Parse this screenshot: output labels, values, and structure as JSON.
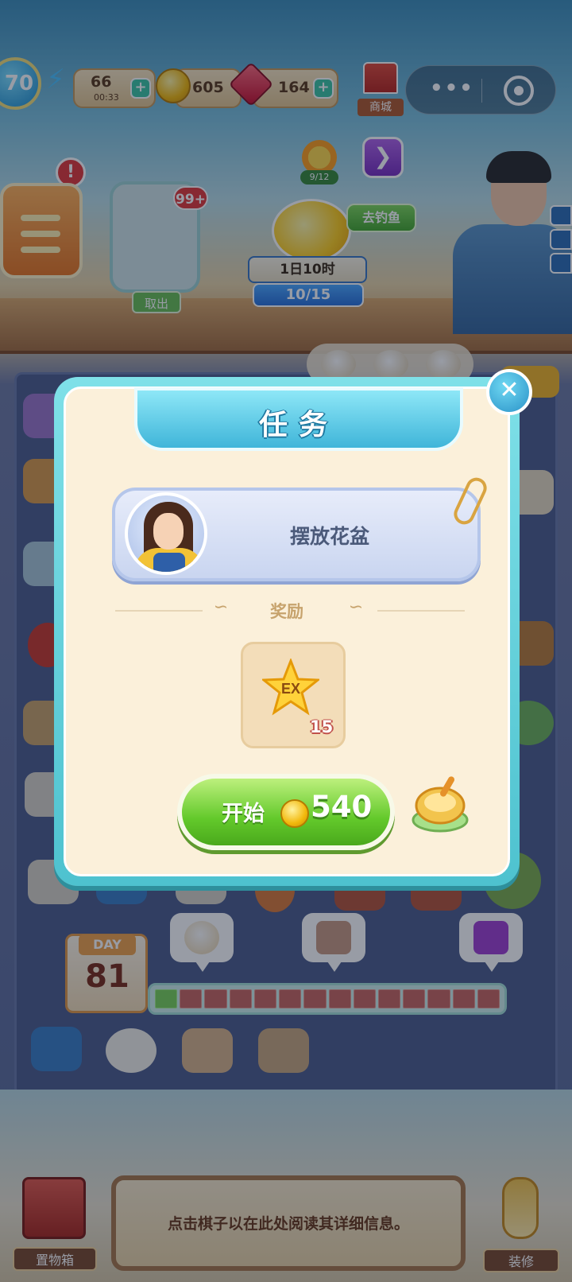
{
  "hud": {
    "level": "70",
    "energy": "66",
    "energy_timer": "00:33",
    "coins": "605",
    "gems": "164",
    "shop_label": "商城",
    "plus_symbol": "+"
  },
  "capsule": {
    "more_glyph": "•••"
  },
  "scene": {
    "alert_glyph": "!",
    "storage_badge": "99+",
    "storage_take_label": "取出",
    "sunflower_progress": "9/12",
    "fishing": {
      "timer": "1日10时",
      "progress": "10/15",
      "go_label": "去钓鱼"
    }
  },
  "modal": {
    "title": "任务",
    "close_glyph": "✕",
    "task_name": "摆放花盆",
    "reward_title": "奖励",
    "reward_item": {
      "label": "EX",
      "quantity": "15"
    },
    "start_label": "开始",
    "start_cost": "540"
  },
  "day_progress": {
    "day_label": "DAY",
    "day_number": "81",
    "segments_total": 14,
    "segments_done": 1
  },
  "bottom": {
    "storage_label": "置物箱",
    "info_text": "点击棋子以在此处阅读其详细信息。",
    "decor_label": "装修"
  },
  "colors": {
    "modal_frame": "#4ec2cf",
    "start_button": "#63c92b",
    "badge_red": "#e23a3a",
    "coin": "#f2b90c"
  },
  "icons": [
    "energy-icon",
    "coin-icon",
    "gem-icon",
    "shop-icon",
    "close-icon",
    "ex-star-icon",
    "coin-icon",
    "pot-icon",
    "storage-crate-icon",
    "decor-bottle-icon"
  ]
}
